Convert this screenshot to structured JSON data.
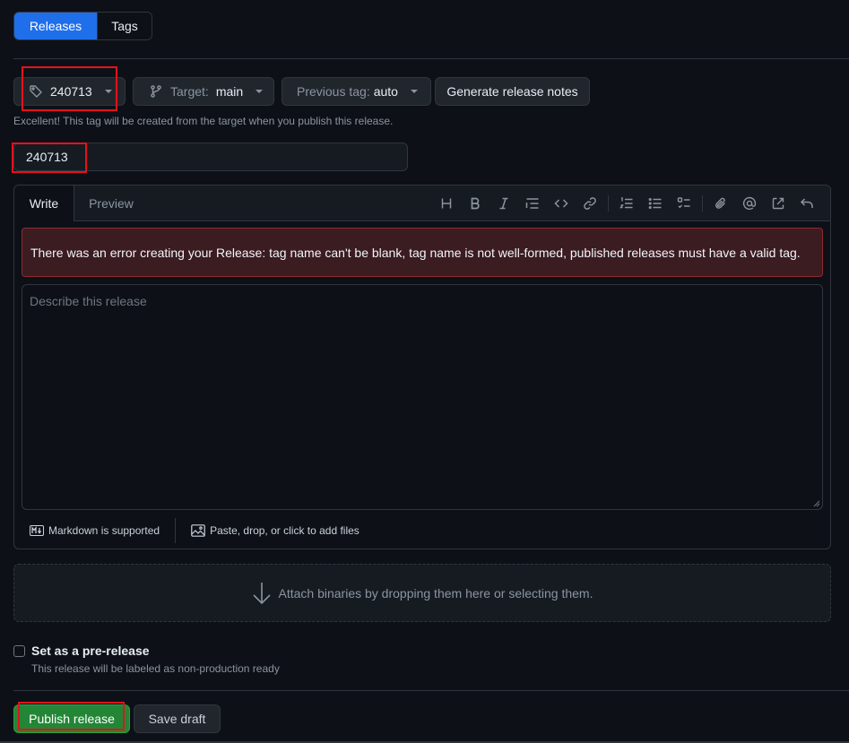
{
  "tabs": {
    "releases": "Releases",
    "tags": "Tags"
  },
  "tag_select": {
    "value": "240713"
  },
  "target_select": {
    "label": "Target:",
    "value": "main"
  },
  "previous_tag": {
    "label": "Previous tag:",
    "value": "auto"
  },
  "generate_notes": "Generate release notes",
  "tag_hint": "Excellent! This tag will be created from the target when you publish this release.",
  "release_title": {
    "value": "240713"
  },
  "editor": {
    "tab_write": "Write",
    "tab_preview": "Preview",
    "toolbar_icons": [
      "heading-icon",
      "bold-icon",
      "italic-icon",
      "quote-icon",
      "code-icon",
      "link-icon",
      "ordered-list-icon",
      "unordered-list-icon",
      "task-list-icon",
      "attach-icon",
      "mention-icon",
      "reference-icon",
      "undo-icon"
    ],
    "error": "There was an error creating your Release: tag name can't be blank, tag name is not well-formed, published releases must have a valid tag.",
    "placeholder": "Describe this release",
    "markdown_note": "Markdown is supported",
    "attach_note": "Paste, drop, or click to add files"
  },
  "dropzone": "Attach binaries by dropping them here or selecting them.",
  "prerelease": {
    "label": "Set as a pre-release",
    "sub": "This release will be labeled as non-production ready",
    "checked": false
  },
  "publish": "Publish release",
  "save_draft": "Save draft",
  "colors": {
    "accent": "#1f6feb",
    "publish": "#238636",
    "error_bg": "#3b1c21",
    "highlight": "#e5121b"
  }
}
